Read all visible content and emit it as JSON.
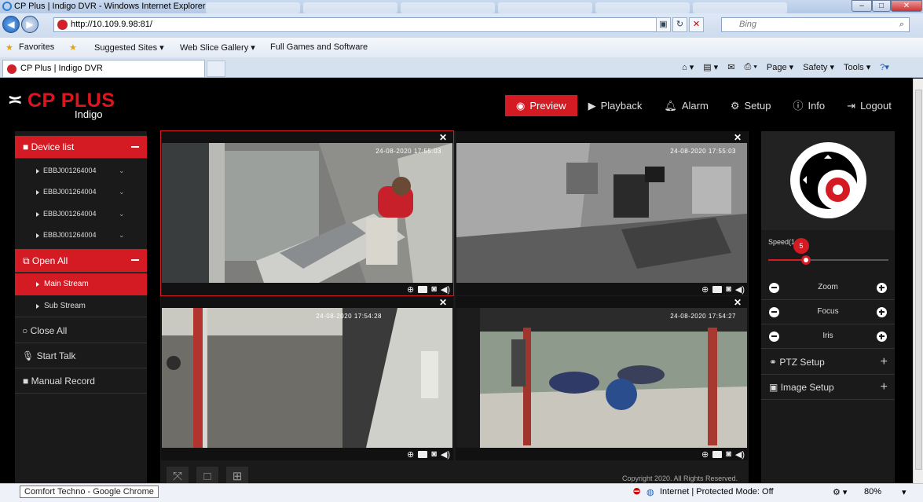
{
  "browser": {
    "window_title": "CP Plus | Indigo DVR - Windows Internet Explorer",
    "window_controls": [
      "–",
      "□",
      "✕"
    ],
    "address": "http://10.109.9.98:81/",
    "search_placeholder": "Bing",
    "favorites_label": "Favorites",
    "favorites_items": [
      "Suggested Sites ▾",
      "Web Slice Gallery ▾",
      "Full Games and Software"
    ],
    "tab_title": "CP Plus | Indigo DVR",
    "command_items": [
      "Page ▾",
      "Safety ▾",
      "Tools ▾"
    ],
    "status_zone": "Internet | Protected Mode: Off",
    "zoom": "80%",
    "tooltip": "Comfort Techno - Google Chrome"
  },
  "header": {
    "brand": "CP PLUS",
    "brand_sub": "Indigo",
    "nav": [
      "Preview",
      "Playback",
      "Alarm",
      "Setup",
      "Info",
      "Logout"
    ],
    "active_nav": "Preview",
    "accent_color": "#d41a23"
  },
  "left_panel": {
    "device_list_label": "Device list",
    "devices": [
      "EBBJ001264004",
      "EBBJ001264004",
      "EBBJ001264004",
      "EBBJ001264004"
    ],
    "open_all_label": "Open All",
    "main_stream_label": "Main Stream",
    "sub_stream_label": "Sub Stream",
    "close_all_label": "Close All",
    "start_talk_label": "Start Talk",
    "manual_record_label": "Manual Record"
  },
  "video": {
    "cells": [
      {
        "timestamp": "24-08-2020 17:55:03"
      },
      {
        "timestamp": "24-08-2020 17:55:03"
      },
      {
        "timestamp": "24-08-2020 17:54:28"
      },
      {
        "timestamp": "24-08-2020 17:54:27"
      }
    ],
    "copyright": "Copyright 2020. All Rights Reserved."
  },
  "ptz": {
    "speed_label": "Speed(1-8)",
    "speed_value": "5",
    "speed_level": 5,
    "speed_max": 8,
    "zoom_label": "Zoom",
    "focus_label": "Focus",
    "iris_label": "Iris",
    "ptz_setup_label": "PTZ Setup",
    "image_setup_label": "Image Setup"
  }
}
